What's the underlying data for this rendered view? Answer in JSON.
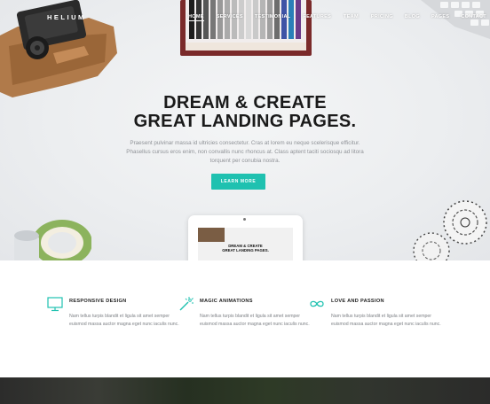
{
  "brand": {
    "logo": "HELIUM"
  },
  "nav": {
    "items": [
      "HOME",
      "SERVICES",
      "TESTIMONIAL",
      "FEATURES",
      "TEAM",
      "PRICING",
      "BLOG",
      "PAGES",
      "CONTACT"
    ]
  },
  "hero": {
    "headline_line1": "DREAM & CREATE",
    "headline_line2": "GREAT LANDING PAGES.",
    "lead_line1": "Praesent pulvinar massa id ultricies consectetur. Cras at lorem eu neque scelerisque efficitur.",
    "lead_line2": "Phasellus cursus eros enim, non convallis nunc rhoncus at. Class aptent taciti sociosqu ad litora",
    "lead_line3": "torquent per conubia nostra.",
    "cta_label": "LEARN MORE",
    "tablet_line1": "DREAM & CREATE",
    "tablet_line2": "GREAT LANDING PAGES."
  },
  "features": [
    {
      "title": "RESPONSIVE DESIGN",
      "icon": "monitor-icon",
      "text": "Nam tellus turpis blandit et ligula sit amet semper euismod massa auctor magna eget nunc iaculis nunc."
    },
    {
      "title": "MAGIC ANIMATIONS",
      "icon": "magic-wand-icon",
      "text": "Nam tellus turpis blandit et ligula sit amet semper euismod massa auctor magna eget nunc iaculis nunc."
    },
    {
      "title": "LOVE AND PASSION",
      "icon": "infinity-icon",
      "text": "Nam tellus turpis blandit et ligula sit amet semper euismod massa auctor magna eget nunc iaculis nunc."
    }
  ],
  "colors": {
    "accent": "#1fc1b0",
    "heading": "#1a1a1a",
    "body_text": "#8f9297"
  }
}
